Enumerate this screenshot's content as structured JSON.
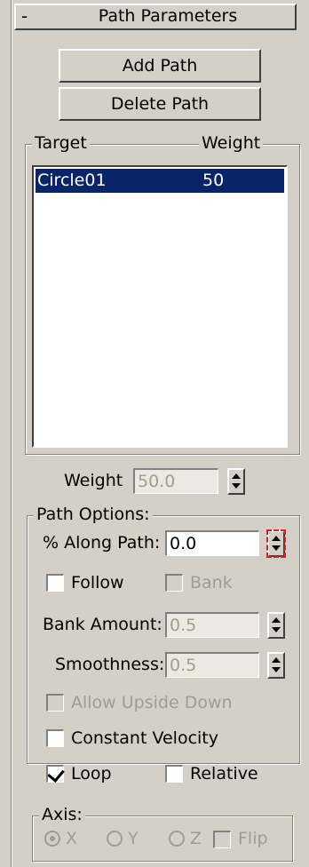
{
  "rollout": {
    "toggle": "-",
    "title": "Path Parameters"
  },
  "buttons": {
    "add_path": "Add Path",
    "delete_path": "Delete Path"
  },
  "targets": {
    "header_target": "Target",
    "header_weight": "Weight",
    "rows": [
      {
        "target": "Circle01",
        "weight": "50",
        "selected": true
      }
    ]
  },
  "weight": {
    "label": "Weight",
    "value": "50.0"
  },
  "path_options": {
    "title": "Path Options:",
    "along_path_label": "% Along Path:",
    "along_path_value": "0.0",
    "follow_label": "Follow",
    "follow_checked": false,
    "bank_label": "Bank",
    "bank_checked": false,
    "bank_amount_label": "Bank Amount:",
    "bank_amount_value": "0.5",
    "smoothness_label": "Smoothness:",
    "smoothness_value": "0.5",
    "allow_upside_down_label": "Allow Upside Down",
    "constant_velocity_label": "Constant Velocity",
    "constant_velocity_checked": false,
    "loop_label": "Loop",
    "loop_checked": true,
    "relative_label": "Relative",
    "relative_checked": false
  },
  "axis": {
    "title": "Axis:",
    "x_label": "X",
    "y_label": "Y",
    "z_label": "Z",
    "selected": "X",
    "flip_label": "Flip"
  }
}
